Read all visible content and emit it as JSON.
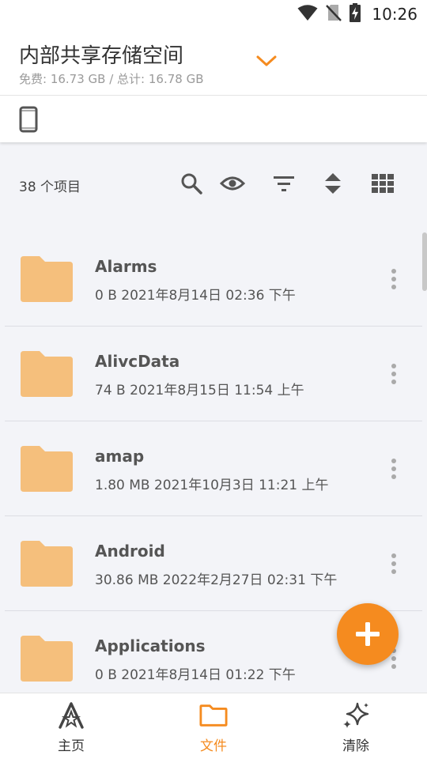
{
  "status_bar": {
    "time": "10:26",
    "icons": [
      "wifi-icon",
      "no-sim-icon",
      "battery-charging-icon"
    ]
  },
  "storage": {
    "title": "内部共享存储空间",
    "free": "免费: 16.73 GB",
    "separator": " / ",
    "total": "总计: 16.78 GB"
  },
  "toolbar": {
    "count": "38 个项目",
    "icons": [
      "search-icon",
      "eye-icon",
      "filter-icon",
      "sort-icon",
      "grid-view-icon"
    ]
  },
  "files": [
    {
      "name": "Alarms",
      "meta": "0 B 2021年8月14日 02:36 下午"
    },
    {
      "name": "AlivcData",
      "meta": "74 B 2021年8月15日 11:54 上午"
    },
    {
      "name": "amap",
      "meta": "1.80 MB 2021年10月3日 11:21 上午"
    },
    {
      "name": "Android",
      "meta": "30.86 MB 2022年2月27日 02:31 下午"
    },
    {
      "name": "Applications",
      "meta": "0 B 2021年8月14日 01:22 下午"
    }
  ],
  "nav": {
    "home": "主页",
    "files": "文件",
    "clean": "清除"
  },
  "colors": {
    "accent": "#f58b1f",
    "folder": "#f5bf7c",
    "background": "#f3f4f8"
  }
}
